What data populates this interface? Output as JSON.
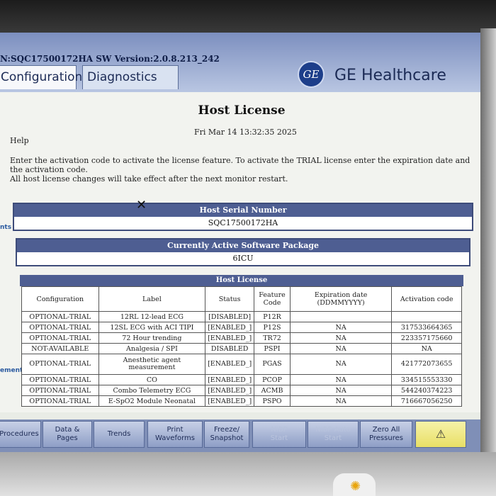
{
  "header": {
    "serial_sw": "N:SQC17500172HA  SW Version:2.0.8.213_242",
    "tabs": [
      {
        "label": "Configuration"
      },
      {
        "label": "Diagnostics"
      }
    ],
    "brand_logo": "GE",
    "brand_name": "GE Healthcare"
  },
  "page": {
    "title": "Host License",
    "datetime": "Fri Mar 14 13:32:35 2025",
    "help": "Help",
    "instructions": [
      "Enter the activation code to activate the license feature. To activate the TRIAL license enter the expiration date and the activation code.",
      "All host license changes will take effect after the next monitor restart."
    ],
    "side_labels": [
      "nts",
      "ement"
    ]
  },
  "serial_panel": {
    "heading": "Host Serial Number",
    "value": "SQC17500172HA"
  },
  "package_panel": {
    "heading": "Currently Active Software Package",
    "value": "6ICU"
  },
  "license_table": {
    "heading": "Host License",
    "columns": [
      "Configuration",
      "Label",
      "Status",
      "Feature Code",
      "Expiration date (DDMMYYYY)",
      "Activation code"
    ],
    "rows": [
      {
        "config": "OPTIONAL-TRIAL",
        "label": "12RL 12-lead ECG",
        "status": "[DISABLED]",
        "code": "P12R",
        "exp": "",
        "act": ""
      },
      {
        "config": "OPTIONAL-TRIAL",
        "label": "12SL ECG with ACI TIPI",
        "status": "[ENABLED_]",
        "code": "P12S",
        "exp": "NA",
        "act": "317533664365"
      },
      {
        "config": "OPTIONAL-TRIAL",
        "label": "72 Hour trending",
        "status": "[ENABLED_]",
        "code": "TR72",
        "exp": "NA",
        "act": "223357175660"
      },
      {
        "config": "NOT-AVAILABLE",
        "label": "Analgesia / SPI",
        "status": "DISABLED",
        "code": "PSPI",
        "exp": "NA",
        "act": "NA"
      },
      {
        "config": "OPTIONAL-TRIAL",
        "label": "Anesthetic agent measurement",
        "status": "[ENABLED_]",
        "code": "PGAS",
        "exp": "NA",
        "act": "421772073655"
      },
      {
        "config": "OPTIONAL-TRIAL",
        "label": "CO",
        "status": "[ENABLED_]",
        "code": "PCOP",
        "exp": "NA",
        "act": "334515553330"
      },
      {
        "config": "OPTIONAL-TRIAL",
        "label": "Combo Telemetry ECG",
        "status": "[ENABLED_]",
        "code": "ACMB",
        "exp": "NA",
        "act": "544240374223"
      },
      {
        "config": "OPTIONAL-TRIAL",
        "label": "E-SpO2 Module Neonatal",
        "status": "[ENABLED_]",
        "code": "PSPO",
        "exp": "NA",
        "act": "716667056250"
      }
    ]
  },
  "softkeys": [
    {
      "label": "Procedures",
      "enabled": true
    },
    {
      "label": "Data &\nPages",
      "enabled": true
    },
    {
      "label": "Trends",
      "enabled": true
    },
    {
      "label": "Print\nWaveforms",
      "enabled": true
    },
    {
      "label": "Freeze/\nSnapshot",
      "enabled": true
    },
    {
      "label": "NIBP\nStart",
      "enabled": false
    },
    {
      "label": "NIBP Auto\nStart",
      "enabled": false
    },
    {
      "label": "Zero All\nPressures",
      "enabled": true
    },
    {
      "label": "⚠",
      "enabled": true
    }
  ],
  "icons": {
    "close": "close-icon",
    "alarm": "alarm-bell-icon",
    "led": "power-led-icon"
  }
}
